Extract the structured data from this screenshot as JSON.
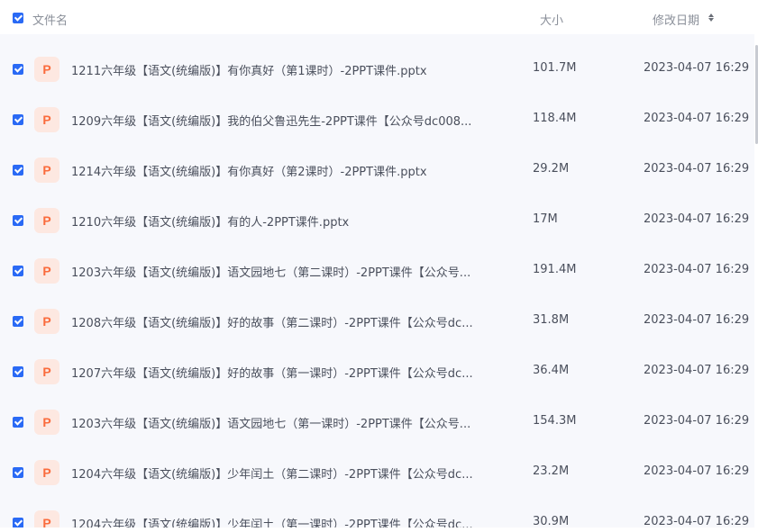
{
  "header": {
    "name_label": "文件名",
    "size_label": "大小",
    "date_label": "修改日期",
    "all_selected": true
  },
  "icons": {
    "checkbox": "checkbox-checked-icon",
    "file": "ppt-file-icon",
    "sort": "sort-icon"
  },
  "colors": {
    "accent": "#2a6af5",
    "ppt_icon": "#fa6b3c",
    "ppt_icon_bg": "#fde8e1",
    "list_bg": "#f7f8fc"
  },
  "file_icon_letter": "P",
  "files": [
    {
      "name": "1211六年级【语文(统编版)】有你真好（第1课时）-2PPT课件.pptx",
      "size": "101.7M",
      "date": "2023-04-07 16:29",
      "selected": true
    },
    {
      "name": "1209六年级【语文(统编版)】我的伯父鲁迅先生-2PPT课件【公众号dc008...",
      "size": "118.4M",
      "date": "2023-04-07 16:29",
      "selected": true
    },
    {
      "name": "1214六年级【语文(统编版)】有你真好（第2课时）-2PPT课件.pptx",
      "size": "29.2M",
      "date": "2023-04-07 16:29",
      "selected": true
    },
    {
      "name": "1210六年级【语文(统编版)】有的人-2PPT课件.pptx",
      "size": "17M",
      "date": "2023-04-07 16:29",
      "selected": true
    },
    {
      "name": "1203六年级【语文(统编版)】语文园地七（第二课时）-2PPT课件【公众号...",
      "size": "191.4M",
      "date": "2023-04-07 16:29",
      "selected": true
    },
    {
      "name": "1208六年级【语文(统编版)】好的故事（第二课时）-2PPT课件【公众号dc...",
      "size": "31.8M",
      "date": "2023-04-07 16:29",
      "selected": true
    },
    {
      "name": "1207六年级【语文(统编版)】好的故事（第一课时）-2PPT课件【公众号dc...",
      "size": "36.4M",
      "date": "2023-04-07 16:29",
      "selected": true
    },
    {
      "name": "1203六年级【语文(统编版)】语文园地七（第一课时）-2PPT课件【公众号...",
      "size": "154.3M",
      "date": "2023-04-07 16:29",
      "selected": true
    },
    {
      "name": "1204六年级【语文(统编版)】少年闰土（第二课时）-2PPT课件【公众号dc...",
      "size": "23.2M",
      "date": "2023-04-07 16:29",
      "selected": true
    },
    {
      "name": "1204六年级【语文(统编版)】少年闰土（第一课时）-2PPT课件【公众号dc...",
      "size": "30.9M",
      "date": "2023-04-07 16:29",
      "selected": true
    }
  ]
}
